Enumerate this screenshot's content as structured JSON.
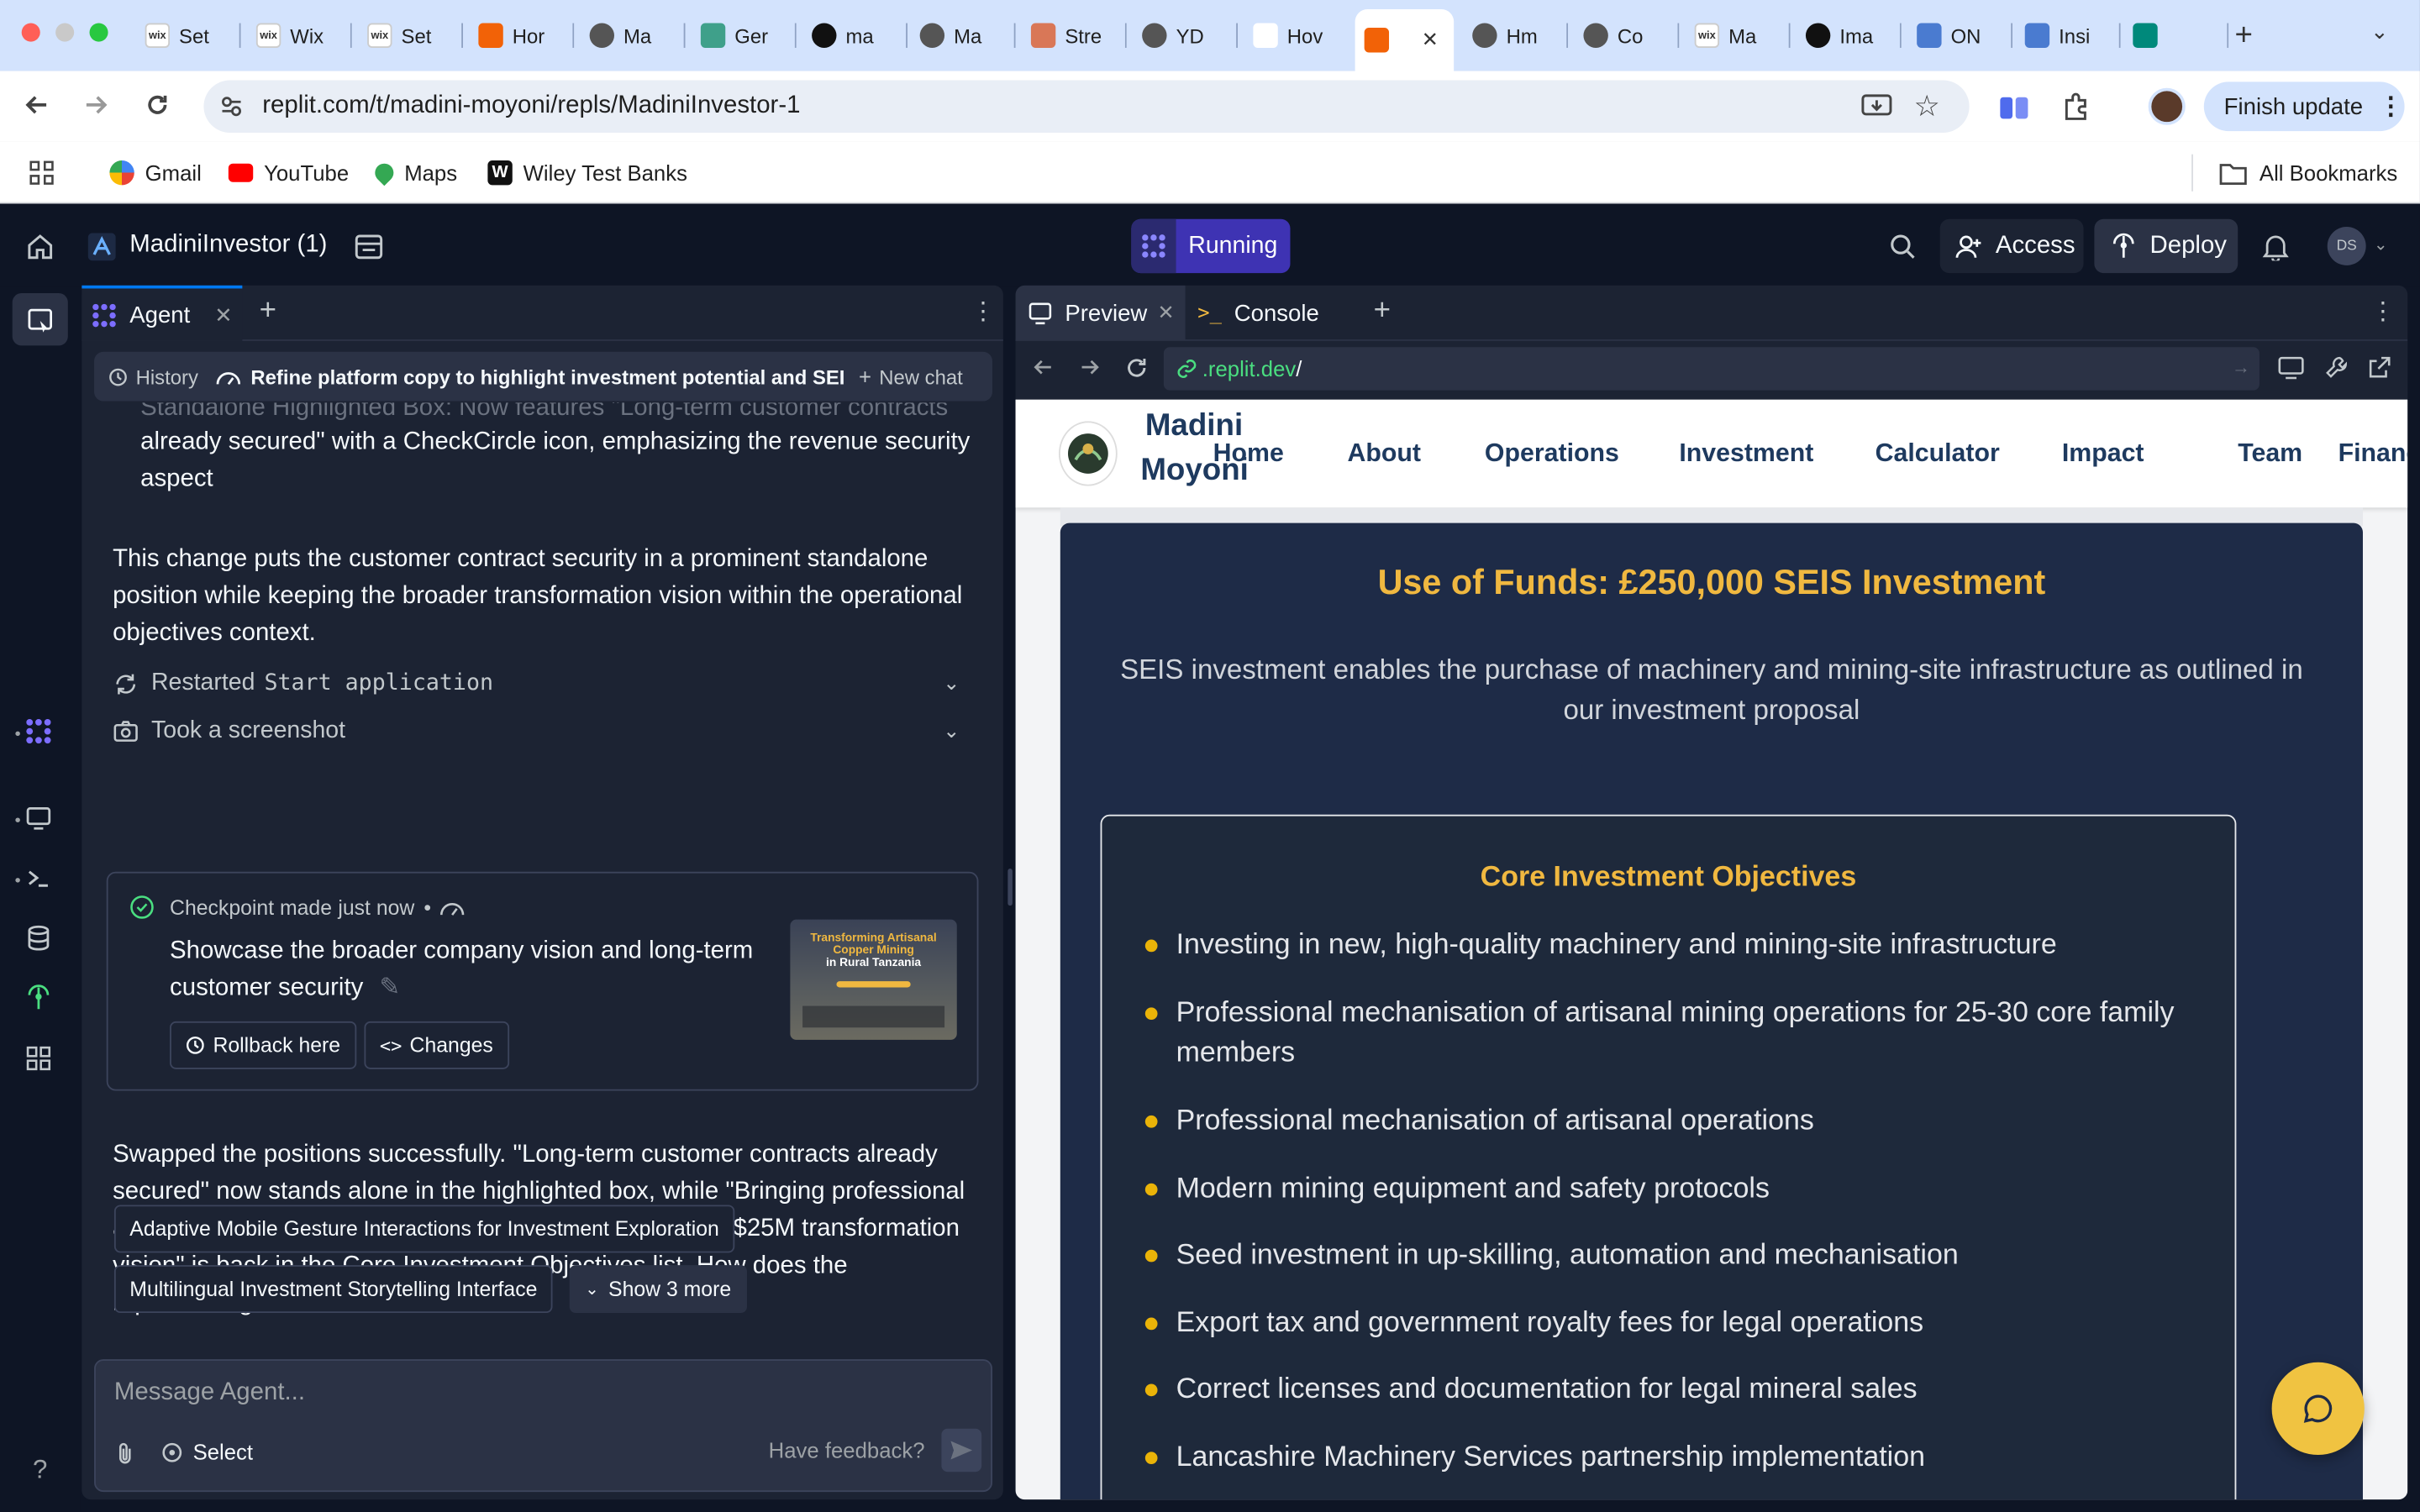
{
  "browser": {
    "tabs": [
      {
        "label": "Set",
        "fav": "wix"
      },
      {
        "label": "Wix",
        "fav": "wix"
      },
      {
        "label": "Set",
        "fav": "wix"
      },
      {
        "label": "Hor",
        "fav": "replit"
      },
      {
        "label": "Ma",
        "fav": "globe"
      },
      {
        "label": "Ger",
        "fav": "gem"
      },
      {
        "label": "ma",
        "fav": "triangle"
      },
      {
        "label": "Ma",
        "fav": "globe"
      },
      {
        "label": "Stre",
        "fav": "star"
      },
      {
        "label": "YD",
        "fav": "globe"
      },
      {
        "label": "Hov",
        "fav": "link"
      },
      {
        "label": "",
        "fav": "replit"
      },
      {
        "label": "Hm",
        "fav": "globe"
      },
      {
        "label": "Co",
        "fav": "globe"
      },
      {
        "label": "Ma",
        "fav": "wix"
      },
      {
        "label": "Ima",
        "fav": "openai"
      },
      {
        "label": "ON",
        "fav": "layers"
      },
      {
        "label": "Insi",
        "fav": "layers"
      },
      {
        "label": "",
        "fav": "meet"
      }
    ],
    "url": "replit.com/t/madini-moyoni/repls/MadiniInvestor-1",
    "finish_update": "Finish update",
    "bookmarks": [
      "Gmail",
      "YouTube",
      "Maps",
      "Wiley Test Banks"
    ],
    "all_bookmarks": "All Bookmarks",
    "wix_text": "wix"
  },
  "replit": {
    "project_name": "MadiniInvestor (1)",
    "run_status": "Running",
    "access": "Access",
    "deploy": "Deploy",
    "avatar_initials": "DS"
  },
  "agent": {
    "tab_label": "Agent",
    "history": "History",
    "chat_title": "Refine platform copy to highlight investment potential and SEI...",
    "new_chat": "New chat",
    "faded_line": "Standalone Highlighted Box: Now features \"Long-term customer contracts",
    "prev_bullet_tail": "already secured\" with a CheckCircle icon, emphasizing the revenue security aspect",
    "paragraph1": "This change puts the customer contract security in a prominent standalone position while keeping the broader transformation vision within the operational objectives context.",
    "activity1_prefix": "Restarted",
    "activity1_code": "Start application",
    "activity2": "Took a screenshot",
    "checkpoint_label": "Checkpoint made",
    "checkpoint_time": "just now",
    "checkpoint_title": "Showcase the broader company vision and long-term customer security",
    "rollback": "Rollback here",
    "changes": "Changes",
    "thumb_title_1": "Transforming Artisanal",
    "thumb_title_2": "Copper Mining",
    "thumb_title_3": "in Rural Tanzania",
    "paragraph2": "Swapped the positions successfully. \"Long-term customer contracts already secured\" now stands alone in the highlighted box, while \"Bringing professional and international dimension to operations within broader $25M transformation vision\" is back in the Core Investment Objectives list. How does the repositioning look?",
    "suggestions": [
      "Adaptive Mobile Gesture Interactions for Investment Exploration",
      "Multilingual Investment Storytelling Interface"
    ],
    "show_more": "Show 3 more",
    "message_placeholder": "Message Agent...",
    "select": "Select",
    "feedback": "Have feedback?"
  },
  "preview": {
    "tab_preview": "Preview",
    "tab_console": "Console",
    "url_host": ".replit.dev",
    "url_path": "/",
    "site": {
      "brand_line1": "Madini",
      "brand_line2": "Moyoni",
      "nav": [
        "Home",
        "About",
        "Operations",
        "Investment",
        "Calculator",
        "Impact",
        "Team",
        "Finance"
      ],
      "funds_title": "Use of Funds: £250,000 SEIS Investment",
      "funds_subtitle": "SEIS investment enables the purchase of machinery and mining-site infrastructure as outlined in our investment proposal",
      "objectives_title": "Core Investment Objectives",
      "objectives": [
        "Investing in new, high-quality machinery and mining-site infrastructure",
        "Professional mechanisation of artisanal mining operations for 25-30 core family members",
        "Professional mechanisation of artisanal operations",
        "Modern mining equipment and safety protocols",
        "Seed investment in up-skilling, automation and mechanisation",
        "Export tax and government royalty fees for legal operations",
        "Correct licenses and documentation for legal mineral sales",
        "Lancashire Machinery Services partnership implementation"
      ]
    }
  },
  "colors": {
    "accent_gold": "#f0b840",
    "replit_purple": "#5b4ef0",
    "panel_navy": "#1e2b47"
  }
}
